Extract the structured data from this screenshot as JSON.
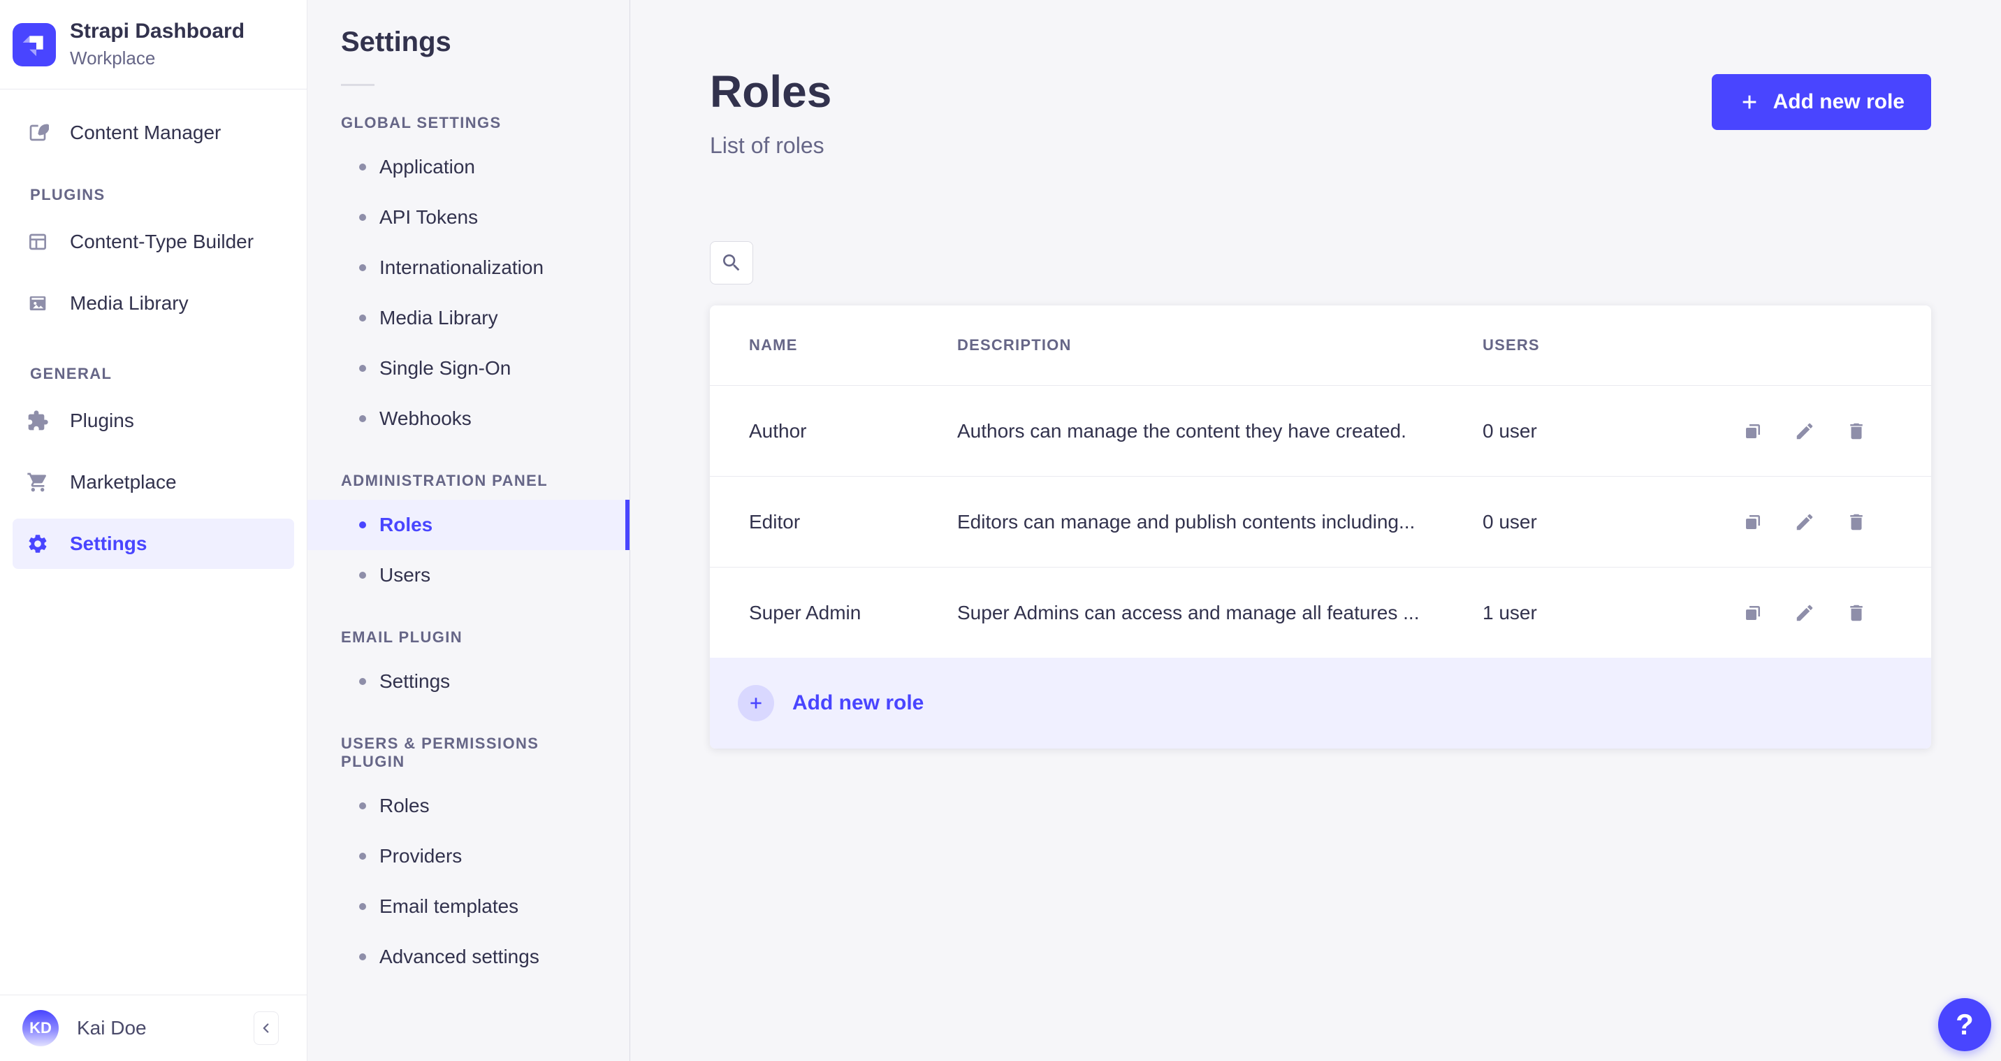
{
  "colors": {
    "primary": "#4945ff",
    "primary_light": "#f0f0ff",
    "primary_pale": "#d9d8ff",
    "text_dark": "#32324d",
    "text_muted": "#666687",
    "icon_muted": "#8e8ea9",
    "background": "#f6f6f9",
    "surface": "#ffffff",
    "border": "#eaeaef"
  },
  "sidebar": {
    "app_title": "Strapi Dashboard",
    "app_subtitle": "Workplace",
    "section_plugins": "PLUGINS",
    "section_general": "GENERAL",
    "items": {
      "content_manager": "Content Manager",
      "content_type_builder": "Content-Type Builder",
      "media_library": "Media Library",
      "plugins": "Plugins",
      "marketplace": "Marketplace",
      "settings": "Settings"
    },
    "user": {
      "initials": "KD",
      "name": "Kai Doe"
    }
  },
  "subnav": {
    "title": "Settings",
    "sections": [
      {
        "title": "GLOBAL SETTINGS",
        "items": [
          "Application",
          "API Tokens",
          "Internationalization",
          "Media Library",
          "Single Sign-On",
          "Webhooks"
        ]
      },
      {
        "title": "ADMINISTRATION PANEL",
        "items": [
          "Roles",
          "Users"
        ]
      },
      {
        "title": "EMAIL PLUGIN",
        "items": [
          "Settings"
        ]
      },
      {
        "title": "USERS & PERMISSIONS PLUGIN",
        "items": [
          "Roles",
          "Providers",
          "Email templates",
          "Advanced settings"
        ]
      }
    ]
  },
  "main": {
    "page_title": "Roles",
    "page_subtitle": "List of roles",
    "add_new_role": "Add new role",
    "table": {
      "col_name": "NAME",
      "col_description": "DESCRIPTION",
      "col_users": "USERS",
      "rows": [
        {
          "name": "Author",
          "description": "Authors can manage the content they have created.",
          "users": "0 user"
        },
        {
          "name": "Editor",
          "description": "Editors can manage and publish contents including...",
          "users": "0 user"
        },
        {
          "name": "Super Admin",
          "description": "Super Admins can access and manage all features ...",
          "users": "1 user"
        }
      ]
    },
    "footer_add": "Add new role",
    "help": "?"
  }
}
